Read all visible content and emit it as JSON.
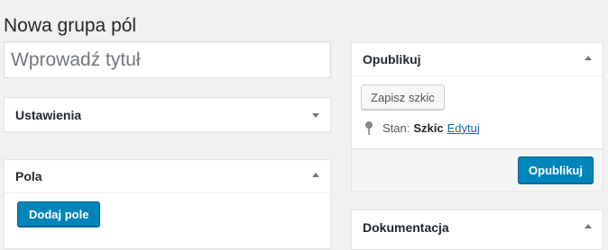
{
  "page": {
    "title": "Nowa grupa pól"
  },
  "title_field": {
    "placeholder": "Wprowadź tytuł",
    "value": ""
  },
  "boxes": {
    "settings": {
      "title": "Ustawienia",
      "state": "collapsed"
    },
    "fields": {
      "title": "Pola",
      "state": "expanded",
      "add_button": "Dodaj pole"
    },
    "publish": {
      "title": "Opublikuj",
      "state": "expanded",
      "save_draft": "Zapisz szkic",
      "status_label": "Stan:",
      "status_value": "Szkic",
      "edit_link": "Edytuj",
      "publish_button": "Opublikuj"
    },
    "docs": {
      "title": "Dokumentacja",
      "state": "expanded"
    }
  },
  "icons": {
    "toggle_up": "chevron-up-icon",
    "toggle_down": "chevron-down-icon",
    "status": "pin-icon"
  },
  "colors": {
    "background": "#f1f1f1",
    "primary": "#0085ba",
    "link": "#0073aa"
  }
}
